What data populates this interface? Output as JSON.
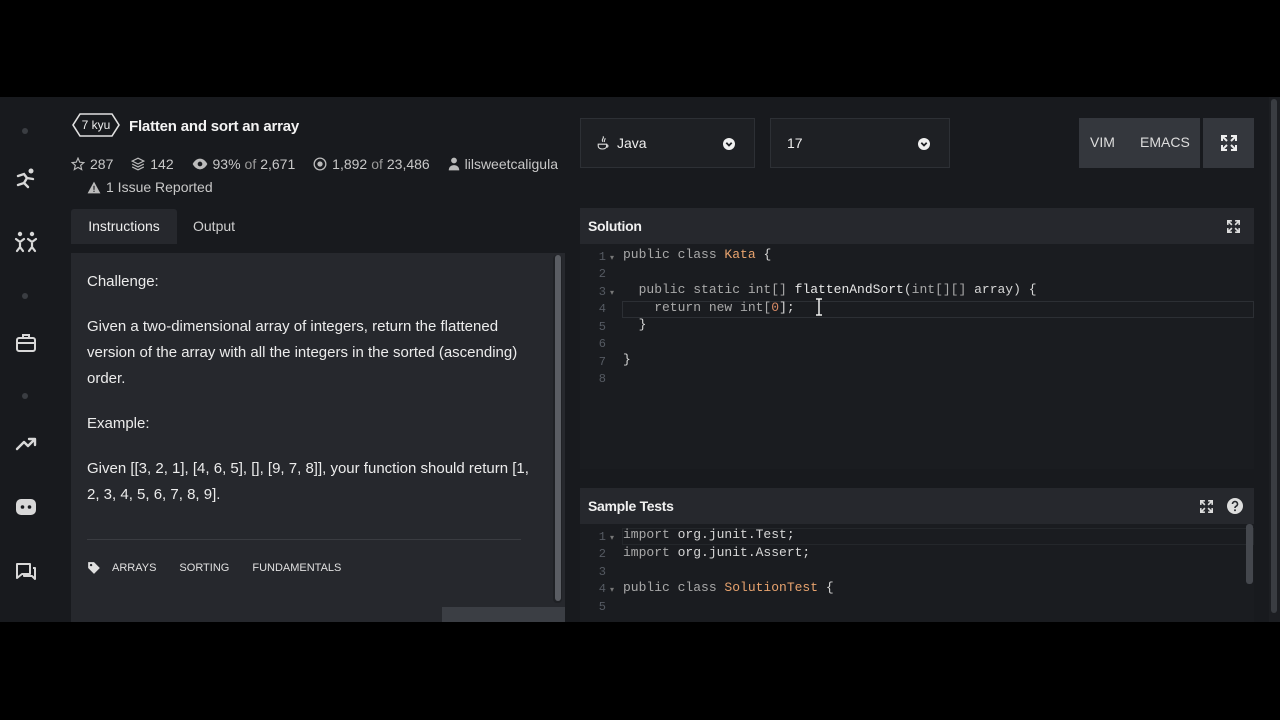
{
  "kata": {
    "rank": "7 kyu",
    "title": "Flatten and sort an array",
    "stars": "287",
    "collections": "142",
    "satisfaction": "93%",
    "satisfaction_of": "of",
    "satisfaction_total": "2,671",
    "completed": "1,892",
    "completed_of": "of",
    "completed_total": "23,486",
    "author": "lilsweetcaligula",
    "issues": "1 Issue Reported"
  },
  "tabs": {
    "instructions": "Instructions",
    "output": "Output"
  },
  "instructions": {
    "challenge_heading": "Challenge:",
    "challenge_text": "Given a two-dimensional array of integers, return the flattened version of the array with all the integers in the sorted (ascending) order.",
    "example_heading": "Example:",
    "example_text": "Given [[3, 2, 1], [4, 6, 5], [], [9, 7, 8]], your function should return [1, 2, 3, 4, 5, 6, 7, 8, 9].",
    "tags": [
      "ARRAYS",
      "SORTING",
      "FUNDAMENTALS"
    ]
  },
  "toolbar": {
    "language": "Java",
    "version": "17",
    "vim": "VIM",
    "emacs": "EMACS"
  },
  "solution": {
    "title": "Solution",
    "lines": [
      "1",
      "2",
      "3",
      "4",
      "5",
      "6",
      "7",
      "8"
    ],
    "code": {
      "l1_kw": "public class ",
      "l1_cls": "Kata",
      "l1_rest": " {",
      "l3_kw": "  public static ",
      "l3_type": "int[] ",
      "l3_fn": "flattenAndSort",
      "l3_p1": "(",
      "l3_ptype": "int[][] ",
      "l3_rest": "array) {",
      "l4_kw": "    return new ",
      "l4_type": "int[",
      "l4_num": "0",
      "l4_rest": "];",
      "l5": "  }",
      "l7": "}"
    }
  },
  "tests": {
    "title": "Sample Tests",
    "lines": [
      "1",
      "2",
      "3",
      "4",
      "5"
    ],
    "code": {
      "l1_kw": "import ",
      "l1_rest": "org.junit.Test;",
      "l2_kw": "import ",
      "l2_rest": "org.junit.Assert;",
      "l4_kw": "public class ",
      "l4_cls": "SolutionTest",
      "l4_rest": " {"
    }
  }
}
